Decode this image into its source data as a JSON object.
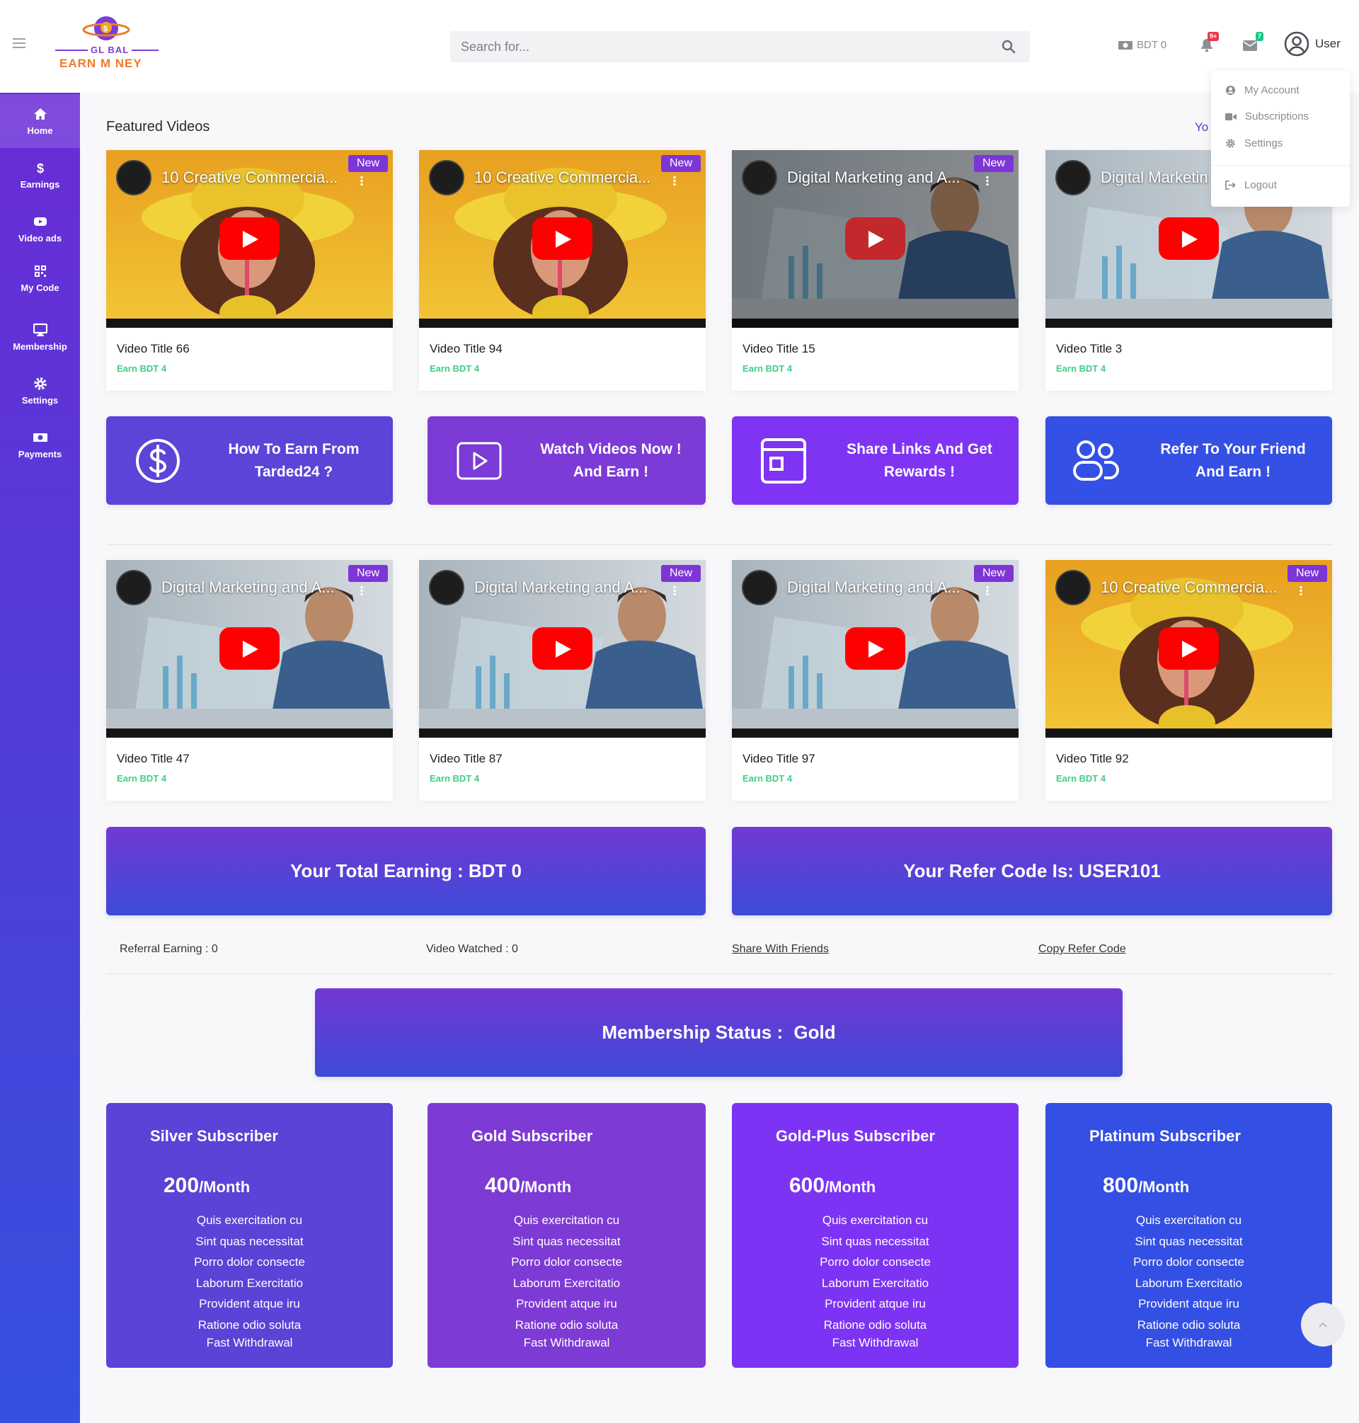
{
  "header": {
    "logo_top": "GL BAL",
    "logo_bottom": "EARN M NEY",
    "search_placeholder": "Search for...",
    "balance": "BDT 0",
    "notif_badge": "9+",
    "msg_badge": "7",
    "user_name": "User"
  },
  "user_menu": {
    "items": [
      "My Account",
      "Subscriptions",
      "Settings"
    ],
    "logout": "Logout"
  },
  "sidebar": {
    "items": [
      {
        "label": "Home",
        "icon": "home-icon"
      },
      {
        "label": "Earnings",
        "icon": "dollar-icon"
      },
      {
        "label": "Video ads",
        "icon": "video-icon"
      },
      {
        "label": "My Code",
        "icon": "qrcode-icon"
      },
      {
        "label": "Membership",
        "icon": "monitor-icon"
      },
      {
        "label": "Settings",
        "icon": "gear-icon"
      },
      {
        "label": "Payments",
        "icon": "money-icon"
      }
    ]
  },
  "featured": {
    "title": "Featured Videos",
    "side_text": "Yo"
  },
  "videos_row1": [
    {
      "thumb_title": "10 Creative Commercia...",
      "badge": "New",
      "name": "Video Title 66",
      "earn": "Earn BDT 4",
      "theme": "yellow"
    },
    {
      "thumb_title": "10 Creative Commercia...",
      "badge": "New",
      "name": "Video Title 94",
      "earn": "Earn BDT 4",
      "theme": "yellow"
    },
    {
      "thumb_title": "Digital Marketing and A...",
      "badge": "New",
      "name": "Video Title 15",
      "earn": "Earn BDT 4",
      "theme": "blue-dim"
    },
    {
      "thumb_title": "Digital Marketin",
      "badge": "New",
      "name": "Video Title 3",
      "earn": "Earn BDT 4",
      "theme": "blue"
    }
  ],
  "cta": [
    {
      "text": "How To Earn From Tarded24 ?",
      "icon": "dollar-circle-icon",
      "color": "#5a45d8"
    },
    {
      "text": "Watch Videos Now ! And Earn !",
      "icon": "play-box-icon",
      "color": "#7c3bd6"
    },
    {
      "text": "Share Links And Get Rewards !",
      "icon": "browser-icon",
      "color": "#7e34f2"
    },
    {
      "text": "Refer To Your Friend And Earn !",
      "icon": "users-icon",
      "color": "#3550e4"
    }
  ],
  "videos_row2": [
    {
      "thumb_title": "Digital Marketing and A...",
      "badge": "New",
      "name": "Video Title 47",
      "earn": "Earn BDT 4",
      "theme": "blue"
    },
    {
      "thumb_title": "Digital Marketing and A...",
      "badge": "New",
      "name": "Video Title 87",
      "earn": "Earn BDT 4",
      "theme": "blue"
    },
    {
      "thumb_title": "Digital Marketing and A...",
      "badge": "New",
      "name": "Video Title 97",
      "earn": "Earn BDT 4",
      "theme": "blue"
    },
    {
      "thumb_title": "10 Creative Commercia...",
      "badge": "New",
      "name": "Video Title 92",
      "earn": "Earn BDT 4",
      "theme": "yellow"
    }
  ],
  "summary": {
    "total_earning": "Your Total Earning : BDT 0",
    "refer_code": "Your Refer Code Is: USER101",
    "referral_earning": "Referral Earning : 0",
    "video_watched": "Video Watched : 0",
    "share_link": "Share With Friends",
    "copy_link": "Copy Refer Code"
  },
  "membership": {
    "label": "Membership Status : ",
    "status": "Gold"
  },
  "plans": [
    {
      "title": "Silver Subscriber",
      "price": "200",
      "per": "/Month",
      "color": "#5c42d6"
    },
    {
      "title": "Gold Subscriber",
      "price": "400",
      "per": "/Month",
      "color": "#7e3ad4"
    },
    {
      "title": "Gold-Plus Subscriber",
      "price": "600",
      "per": "/Month",
      "color": "#7d33f3"
    },
    {
      "title": "Platinum Subscriber",
      "price": "800",
      "per": "/Month",
      "color": "#344fe3"
    }
  ],
  "plan_features": [
    "Quis exercitation cu",
    "Sint quas necessitat",
    "Porro dolor consecte",
    "Laborum Exercitatio",
    "Provident atque iru",
    "Ratione odio soluta",
    "Fast Withdrawal"
  ]
}
